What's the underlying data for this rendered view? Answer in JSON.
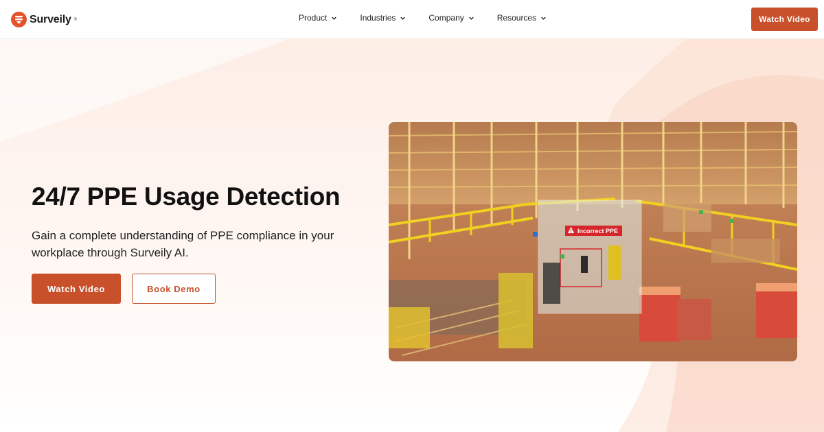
{
  "brand": {
    "name": "Surveily",
    "reg_mark": "®",
    "color": "#e2532b"
  },
  "nav": {
    "items": [
      {
        "label": "Product",
        "icon": "chevron-down-icon"
      },
      {
        "label": "Industries",
        "icon": "chevron-down-icon"
      },
      {
        "label": "Company",
        "icon": "chevron-down-icon"
      },
      {
        "label": "Resources",
        "icon": "chevron-down-icon"
      }
    ],
    "cta_label": "Watch Video"
  },
  "hero": {
    "title": "24/7 PPE Usage Detection",
    "subtitle": "Gain a complete understanding of PPE compliance in your workplace through Surveily AI.",
    "primary_label": "Watch Video",
    "secondary_label": "Book Demo"
  },
  "scene": {
    "detection_label": "Incorrect PPE",
    "detection_icon": "warning-icon",
    "detection_color": "#d6262b"
  },
  "colors": {
    "accent": "#c8502a",
    "background_tint": "#fdeee6"
  }
}
